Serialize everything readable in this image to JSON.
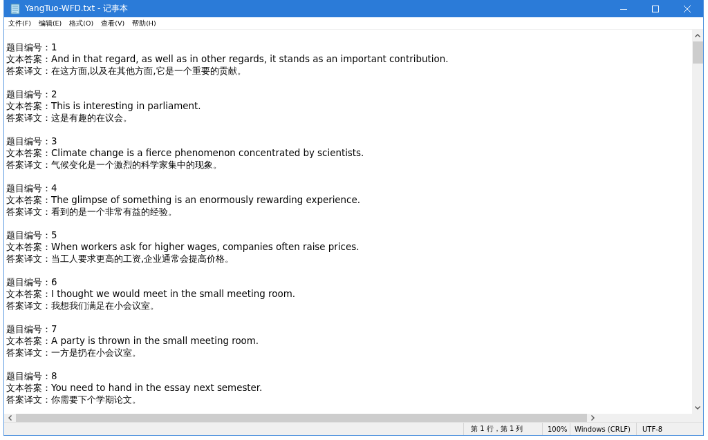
{
  "window": {
    "title": "YangTuo-WFD.txt - 记事本"
  },
  "menu": [
    {
      "label": "文件(F)"
    },
    {
      "label": "编辑(E)"
    },
    {
      "label": "格式(O)"
    },
    {
      "label": "查看(V)"
    },
    {
      "label": "帮助(H)"
    }
  ],
  "entries": [
    {
      "lines": [
        "题目编号：1",
        "文本答案：And in that regard, as well as in other regards, it stands as an important contribution.",
        "答案译文：在这方面,以及在其他方面,它是一个重要的贡献。"
      ]
    },
    {
      "lines": [
        "题目编号：2",
        "文本答案：This is interesting in parliament.",
        "答案译文：这是有趣的在议会。"
      ]
    },
    {
      "lines": [
        "题目编号：3",
        "文本答案：Climate change is a fierce phenomenon concentrated by scientists.",
        "答案译文：气候变化是一个激烈的科学家集中的现象。"
      ]
    },
    {
      "lines": [
        "题目编号：4",
        "文本答案：The glimpse of something is an enormously rewarding experience.",
        "答案译文：看到的是一个非常有益的经验。"
      ]
    },
    {
      "lines": [
        "题目编号：5",
        "文本答案：When workers ask for higher wages, companies often raise prices.",
        "答案译文：当工人要求更高的工资,企业通常会提高价格。"
      ]
    },
    {
      "lines": [
        "题目编号：6",
        "文本答案：I thought we would meet in the small meeting room.",
        "答案译文：我想我们满足在小会议室。"
      ]
    },
    {
      "lines": [
        "题目编号：7",
        "文本答案：A party is thrown in the small meeting room.",
        "答案译文：一方是扔在小会议室。"
      ]
    },
    {
      "lines": [
        "题目编号：8",
        "文本答案：You need to hand in the essay next semester.",
        "答案译文：你需要下个学期论文。"
      ]
    }
  ],
  "status_bar": {
    "position": "第 1 行，第 1 列",
    "zoom": "100%",
    "line_ending": "Windows (CRLF)",
    "encoding": "UTF-8"
  }
}
